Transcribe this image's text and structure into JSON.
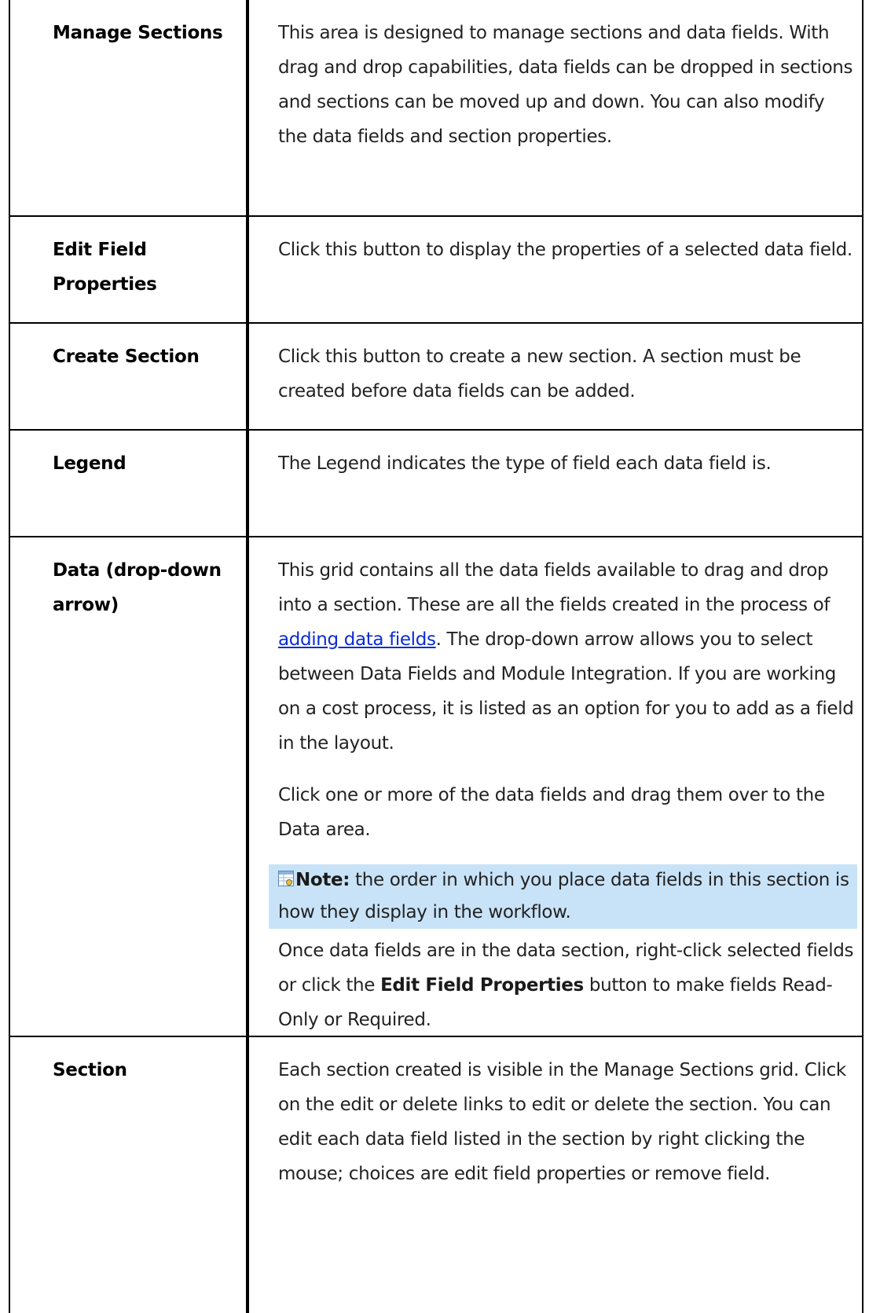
{
  "rows": [
    {
      "label": "Manage Sections",
      "description": "This area is designed to manage sections and data fields. With drag and drop capabilities, data fields can be dropped in sections and sections can be moved up and down. You can also modify the data fields and section properties."
    },
    {
      "label_line1": "Edit Field",
      "label_line2": "Properties",
      "description": "Click this button to display the properties of a selected data field."
    },
    {
      "label": "Create Section",
      "description": "Click this button to create a new section. A section must be created before data fields can be added."
    },
    {
      "label": "Legend",
      "description": "The Legend indicates the type of field each data field is."
    },
    {
      "label_line1": "Data (drop-down",
      "label_line2": "arrow)",
      "desc_before_link": "This grid contains all the data fields available to drag and drop into a section. These are all the fields created in the process of ",
      "link_text": "adding data fields",
      "desc_after_link": ". The drop-down arrow allows you to select between Data Fields and Module Integration. If you are working on a cost process, it is listed as an option for you to add as a field in the layout.",
      "para2": "Click one or more of the data fields and drag them over to the Data area.",
      "note_label": "Note:",
      "note_text": " the order in which you place data fields in this section is how they display in the workflow.",
      "para3_before": "Once data fields are in the data section, right-click selected fields or click the ",
      "para3_bold": "Edit Field Properties",
      "para3_after": " button to make fields Read-Only or Required."
    },
    {
      "label": "Section",
      "description": "Each section created is visible in the Manage Sections grid. Click on the edit or delete links to edit or delete the section. You can edit each data field listed in the section by right clicking the mouse; choices are edit field properties or remove field."
    }
  ],
  "icon": "note-icon",
  "colors": {
    "note_background": "#c8e3f8",
    "link": "#0b2bd6",
    "border": "#000000"
  }
}
